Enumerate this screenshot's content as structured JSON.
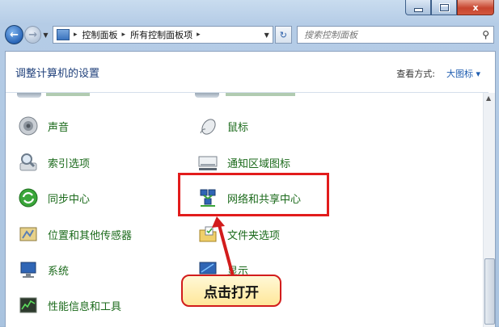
{
  "titlebar": {
    "minimize_glyph": "",
    "maximize_glyph": "",
    "close_glyph": "x"
  },
  "nav": {
    "back_glyph": "←",
    "forward_glyph": "→",
    "breadcrumbs": [
      "控制面板",
      "所有控制面板项"
    ],
    "breadcrumb_sep": "▸",
    "refresh_glyph": "↻",
    "search_placeholder": "搜索控制面板"
  },
  "header": {
    "title": "调整计算机的设置",
    "view_by_label": "查看方式:",
    "view_by_value": "大图标 ▾"
  },
  "items_left": [
    {
      "label": "声音",
      "icon": "speaker-icon"
    },
    {
      "label": "索引选项",
      "icon": "index-search-icon"
    },
    {
      "label": "同步中心",
      "icon": "sync-icon"
    },
    {
      "label": "位置和其他传感器",
      "icon": "location-sensor-icon"
    },
    {
      "label": "系统",
      "icon": "computer-icon"
    },
    {
      "label": "性能信息和工具",
      "icon": "performance-icon"
    }
  ],
  "items_right": [
    {
      "label": "鼠标",
      "icon": "mouse-icon"
    },
    {
      "label": "通知区域图标",
      "icon": "notification-area-icon"
    },
    {
      "label": "网络和共享中心",
      "icon": "network-sharing-icon"
    },
    {
      "label": "文件夹选项",
      "icon": "folder-options-icon"
    },
    {
      "label": "显示",
      "icon": "display-icon"
    }
  ],
  "callout": {
    "text": "点击打开"
  },
  "colors": {
    "highlight": "#e21c1c",
    "link_green": "#1b6a1b",
    "title_blue": "#1e3f7a"
  }
}
